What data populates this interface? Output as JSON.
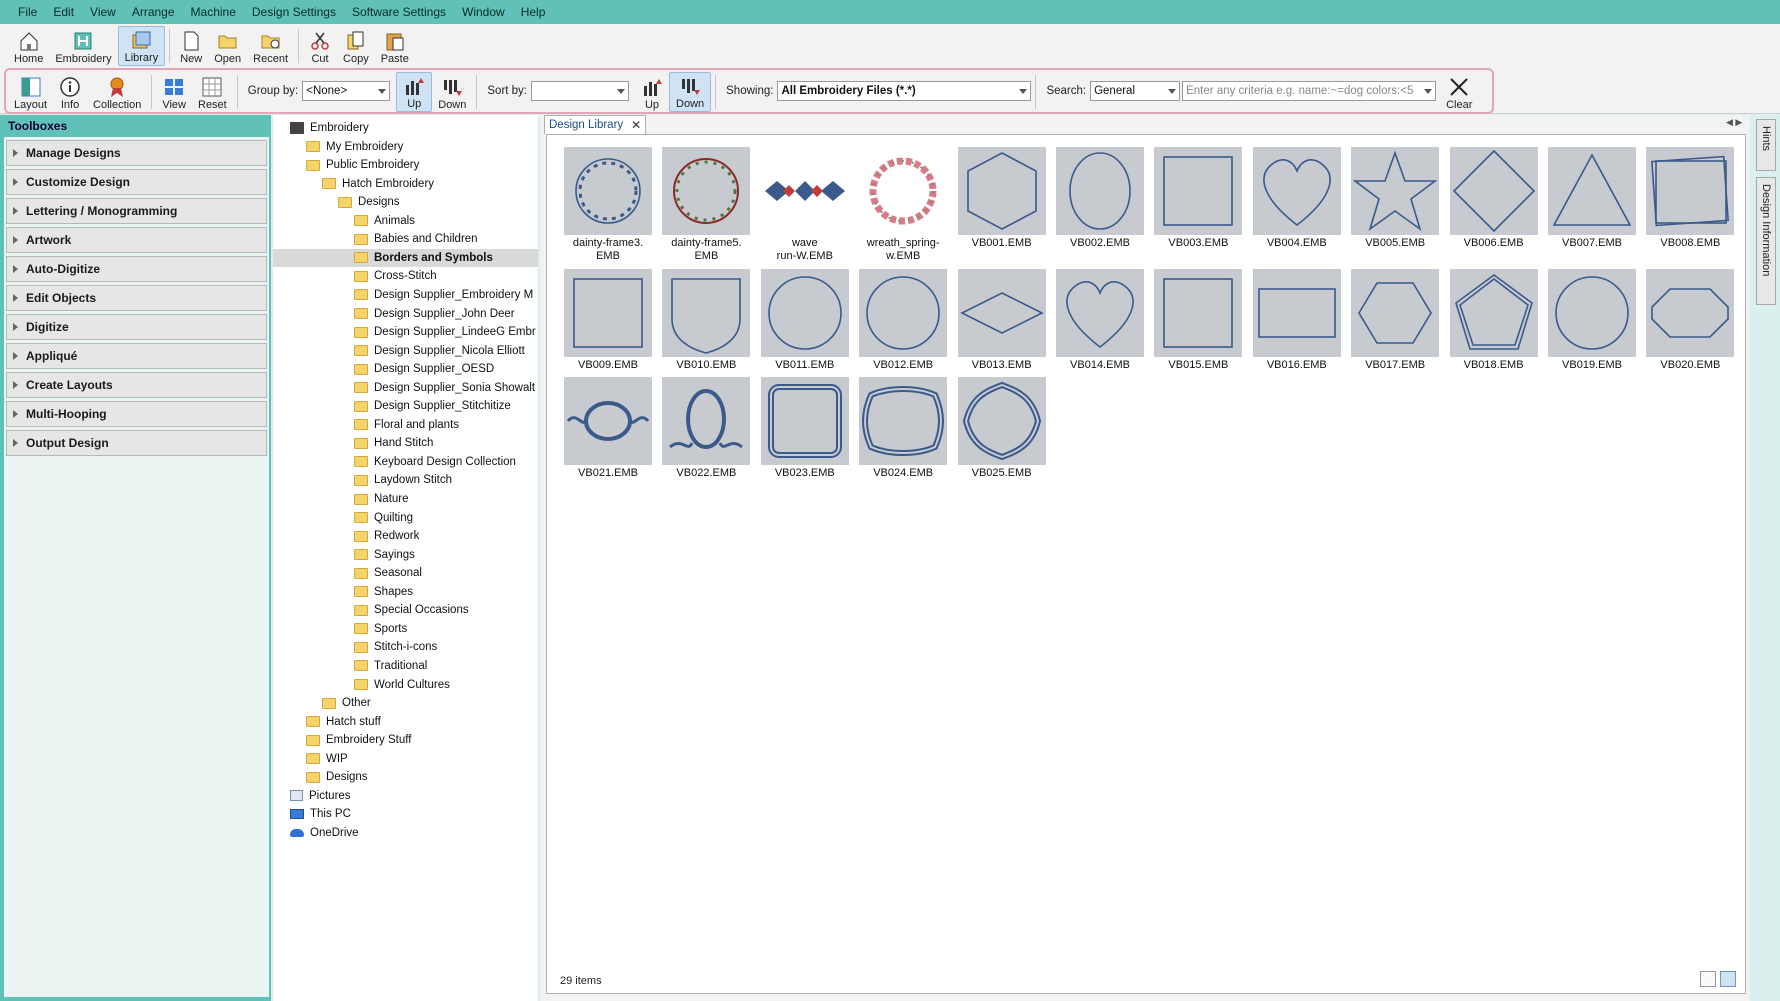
{
  "menu": [
    "File",
    "Edit",
    "View",
    "Arrange",
    "Machine",
    "Design Settings",
    "Software Settings",
    "Window",
    "Help"
  ],
  "toolbar1": [
    {
      "label": "Home",
      "icon": "home-icon"
    },
    {
      "label": "Embroidery",
      "icon": "embroidery-icon"
    },
    {
      "label": "Library",
      "icon": "library-icon",
      "active": true
    },
    {
      "label": "New",
      "icon": "new-file-icon"
    },
    {
      "label": "Open",
      "icon": "open-folder-icon"
    },
    {
      "label": "Recent",
      "icon": "recent-icon"
    },
    {
      "label": "Cut",
      "icon": "cut-icon"
    },
    {
      "label": "Copy",
      "icon": "copy-icon"
    },
    {
      "label": "Paste",
      "icon": "paste-icon"
    }
  ],
  "toolbar2": {
    "layout": "Layout",
    "info": "Info",
    "collection": "Collection",
    "view": "View",
    "reset": "Reset",
    "group_by_label": "Group by:",
    "group_by_value": "<None>",
    "up1": "Up",
    "down1": "Down",
    "sort_by_label": "Sort by:",
    "sort_by_value": "",
    "up2": "Up",
    "down2": "Down",
    "showing_label": "Showing:",
    "showing_value": "All Embroidery Files (*.*)",
    "search_label": "Search:",
    "search_scope": "General",
    "search_placeholder": "Enter any criteria e.g. name:~=dog colors:<5",
    "clear": "Clear"
  },
  "toolboxes": {
    "title": "Toolboxes",
    "items": [
      "Manage Designs",
      "Customize Design",
      "Lettering / Monogramming",
      "Artwork",
      "Auto-Digitize",
      "Edit Objects",
      "Digitize",
      "Appliqué",
      "Create Layouts",
      "Multi-Hooping",
      "Output Design"
    ]
  },
  "tree": [
    {
      "label": "Embroidery",
      "level": 0,
      "icon": "embroidery"
    },
    {
      "label": "My Embroidery",
      "level": 1
    },
    {
      "label": "Public Embroidery",
      "level": 1
    },
    {
      "label": "Hatch Embroidery",
      "level": 2
    },
    {
      "label": "Designs",
      "level": 3
    },
    {
      "label": "Animals",
      "level": 4
    },
    {
      "label": "Babies and Children",
      "level": 4
    },
    {
      "label": "Borders and Symbols",
      "level": 4,
      "selected": true
    },
    {
      "label": "Cross-Stitch",
      "level": 4
    },
    {
      "label": "Design Supplier_Embroidery M",
      "level": 4
    },
    {
      "label": "Design Supplier_John Deer",
      "level": 4
    },
    {
      "label": "Design Supplier_LindeeG Embr",
      "level": 4
    },
    {
      "label": "Design Supplier_Nicola Elliott",
      "level": 4
    },
    {
      "label": "Design Supplier_OESD",
      "level": 4
    },
    {
      "label": "Design Supplier_Sonia Showalt",
      "level": 4
    },
    {
      "label": "Design Supplier_Stitchitize",
      "level": 4
    },
    {
      "label": "Floral and plants",
      "level": 4
    },
    {
      "label": "Hand Stitch",
      "level": 4
    },
    {
      "label": "Keyboard Design Collection",
      "level": 4
    },
    {
      "label": "Laydown Stitch",
      "level": 4
    },
    {
      "label": "Nature",
      "level": 4
    },
    {
      "label": "Quilting",
      "level": 4
    },
    {
      "label": "Redwork",
      "level": 4
    },
    {
      "label": "Sayings",
      "level": 4
    },
    {
      "label": "Seasonal",
      "level": 4
    },
    {
      "label": "Shapes",
      "level": 4
    },
    {
      "label": "Special Occasions",
      "level": 4
    },
    {
      "label": "Sports",
      "level": 4
    },
    {
      "label": "Stitch-i-cons",
      "level": 4
    },
    {
      "label": "Traditional",
      "level": 4
    },
    {
      "label": "World Cultures",
      "level": 4
    },
    {
      "label": "Other",
      "level": 2
    },
    {
      "label": "Hatch stuff",
      "level": 1
    },
    {
      "label": "Embroidery Stuff",
      "level": 1
    },
    {
      "label": "WIP",
      "level": 1
    },
    {
      "label": "Designs",
      "level": 1
    },
    {
      "label": "Pictures",
      "level": 0,
      "icon": "pictures"
    },
    {
      "label": "This PC",
      "level": 0,
      "icon": "pc"
    },
    {
      "label": "OneDrive",
      "level": 0,
      "icon": "onedrive"
    }
  ],
  "library": {
    "tab_label": "Design Library",
    "items": [
      {
        "name": "dainty-frame3.\nEMB",
        "shape": "wreath"
      },
      {
        "name": "dainty-frame5.\nEMB",
        "shape": "wreath-red"
      },
      {
        "name": "wave\nrun-W.EMB",
        "shape": "wave"
      },
      {
        "name": "wreath_spring-\nw.EMB",
        "shape": "wreath-pink"
      },
      {
        "name": "VB001.EMB",
        "shape": "hexagon"
      },
      {
        "name": "VB002.EMB",
        "shape": "oval"
      },
      {
        "name": "VB003.EMB",
        "shape": "square"
      },
      {
        "name": "VB004.EMB",
        "shape": "heart"
      },
      {
        "name": "VB005.EMB",
        "shape": "star"
      },
      {
        "name": "VB006.EMB",
        "shape": "diamond"
      },
      {
        "name": "VB007.EMB",
        "shape": "triangle"
      },
      {
        "name": "VB008.EMB",
        "shape": "rect"
      },
      {
        "name": "VB009.EMB",
        "shape": "square"
      },
      {
        "name": "VB010.EMB",
        "shape": "shield"
      },
      {
        "name": "VB011.EMB",
        "shape": "circle"
      },
      {
        "name": "VB012.EMB",
        "shape": "circle"
      },
      {
        "name": "VB013.EMB",
        "shape": "thin-diamond"
      },
      {
        "name": "VB014.EMB",
        "shape": "heart"
      },
      {
        "name": "VB015.EMB",
        "shape": "square"
      },
      {
        "name": "VB016.EMB",
        "shape": "wide-rect"
      },
      {
        "name": "VB017.EMB",
        "shape": "hexagon-flat"
      },
      {
        "name": "VB018.EMB",
        "shape": "pentagon"
      },
      {
        "name": "VB019.EMB",
        "shape": "circle"
      },
      {
        "name": "VB020.EMB",
        "shape": "octagon"
      },
      {
        "name": "VB021.EMB",
        "shape": "ornate-oval"
      },
      {
        "name": "VB022.EMB",
        "shape": "ornate-egg"
      },
      {
        "name": "VB023.EMB",
        "shape": "ornate-square"
      },
      {
        "name": "VB024.EMB",
        "shape": "ornate-cushion"
      },
      {
        "name": "VB025.EMB",
        "shape": "ornate-round"
      }
    ],
    "count_text": "29 items"
  },
  "rail": {
    "hints": "Hints",
    "design_info": "Design Information"
  },
  "colors": {
    "teal": "#5fc1b8",
    "stitch": "#3a5a8c",
    "thumb_bg": "#c7cbd0",
    "highlight": "#e3a6b7"
  }
}
